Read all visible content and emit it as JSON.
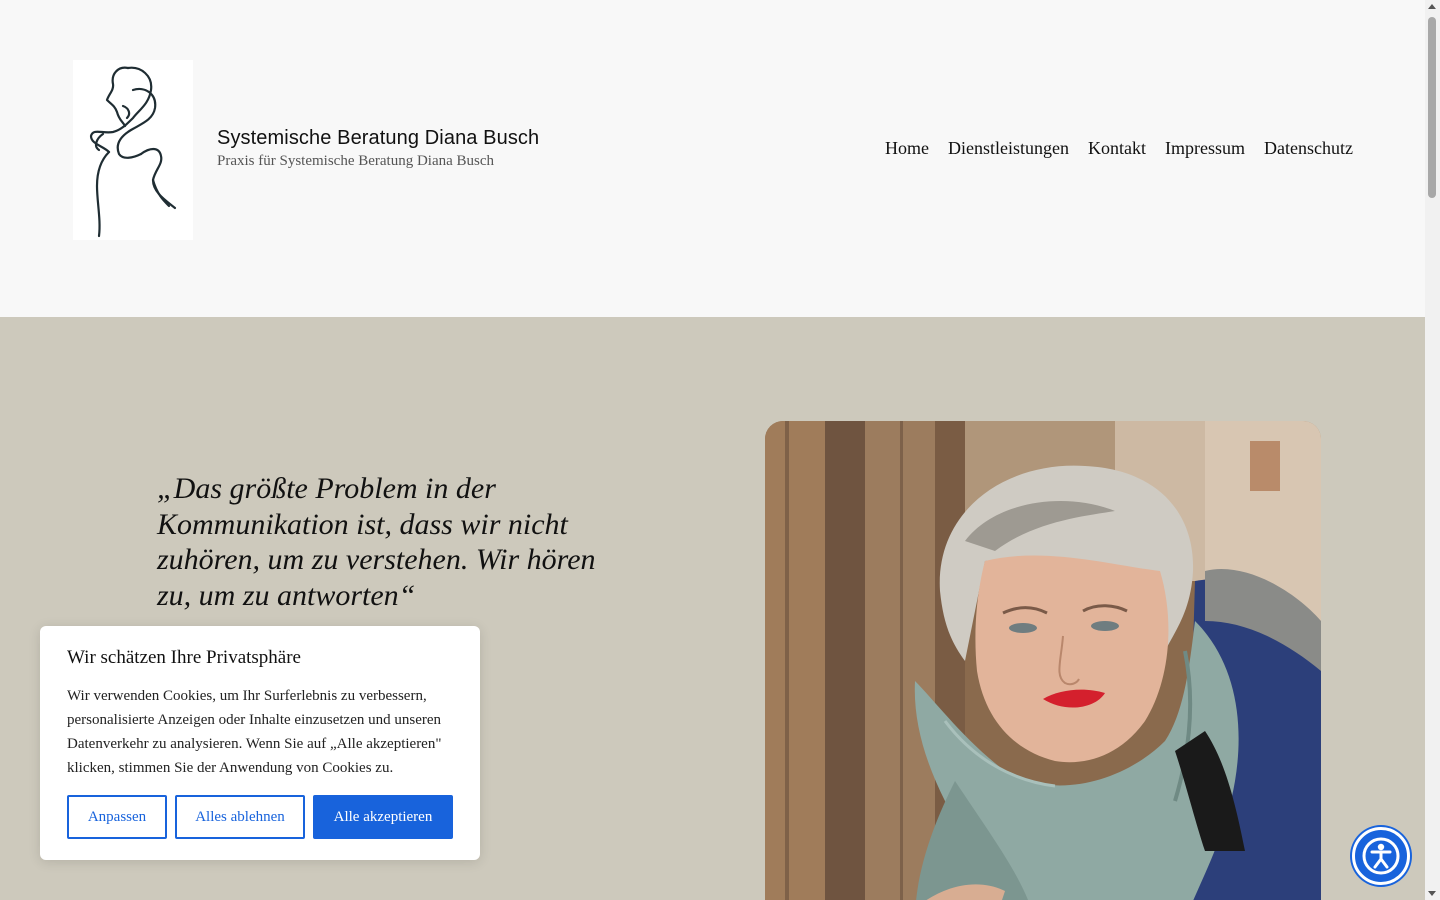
{
  "header": {
    "site_title": "Systemische Beratung Diana Busch",
    "tagline": "Praxis für Systemische Beratung Diana Busch",
    "logo_icon": "line-drawing-woman-logo",
    "nav": [
      {
        "label": "Home"
      },
      {
        "label": "Dienstleistungen"
      },
      {
        "label": "Kontakt"
      },
      {
        "label": "Impressum"
      },
      {
        "label": "Datenschutz"
      }
    ]
  },
  "hero": {
    "quote": "„Das größte Problem in der Kommunikation ist, dass wir nicht zuhören, um zu verstehen. Wir hören zu, um zu antworten“",
    "background_color": "#cdc9bc",
    "photo": "portrait-photo"
  },
  "cookie_banner": {
    "title": "Wir schätzen Ihre Privatsphäre",
    "text": "Wir verwenden Cookies, um Ihr Surferlebnis zu verbessern, personalisierte Anzeigen oder Inhalte einzusetzen und unseren Datenverkehr zu analysieren. Wenn Sie auf „Alle akzeptieren\" klicken, stimmen Sie der Anwendung von Cookies zu.",
    "buttons": {
      "customize": "Anpassen",
      "reject": "Alles ablehnen",
      "accept": "Alle akzeptieren"
    },
    "accent_color": "#1863dc"
  },
  "accessibility_button": {
    "icon": "accessibility-icon"
  }
}
